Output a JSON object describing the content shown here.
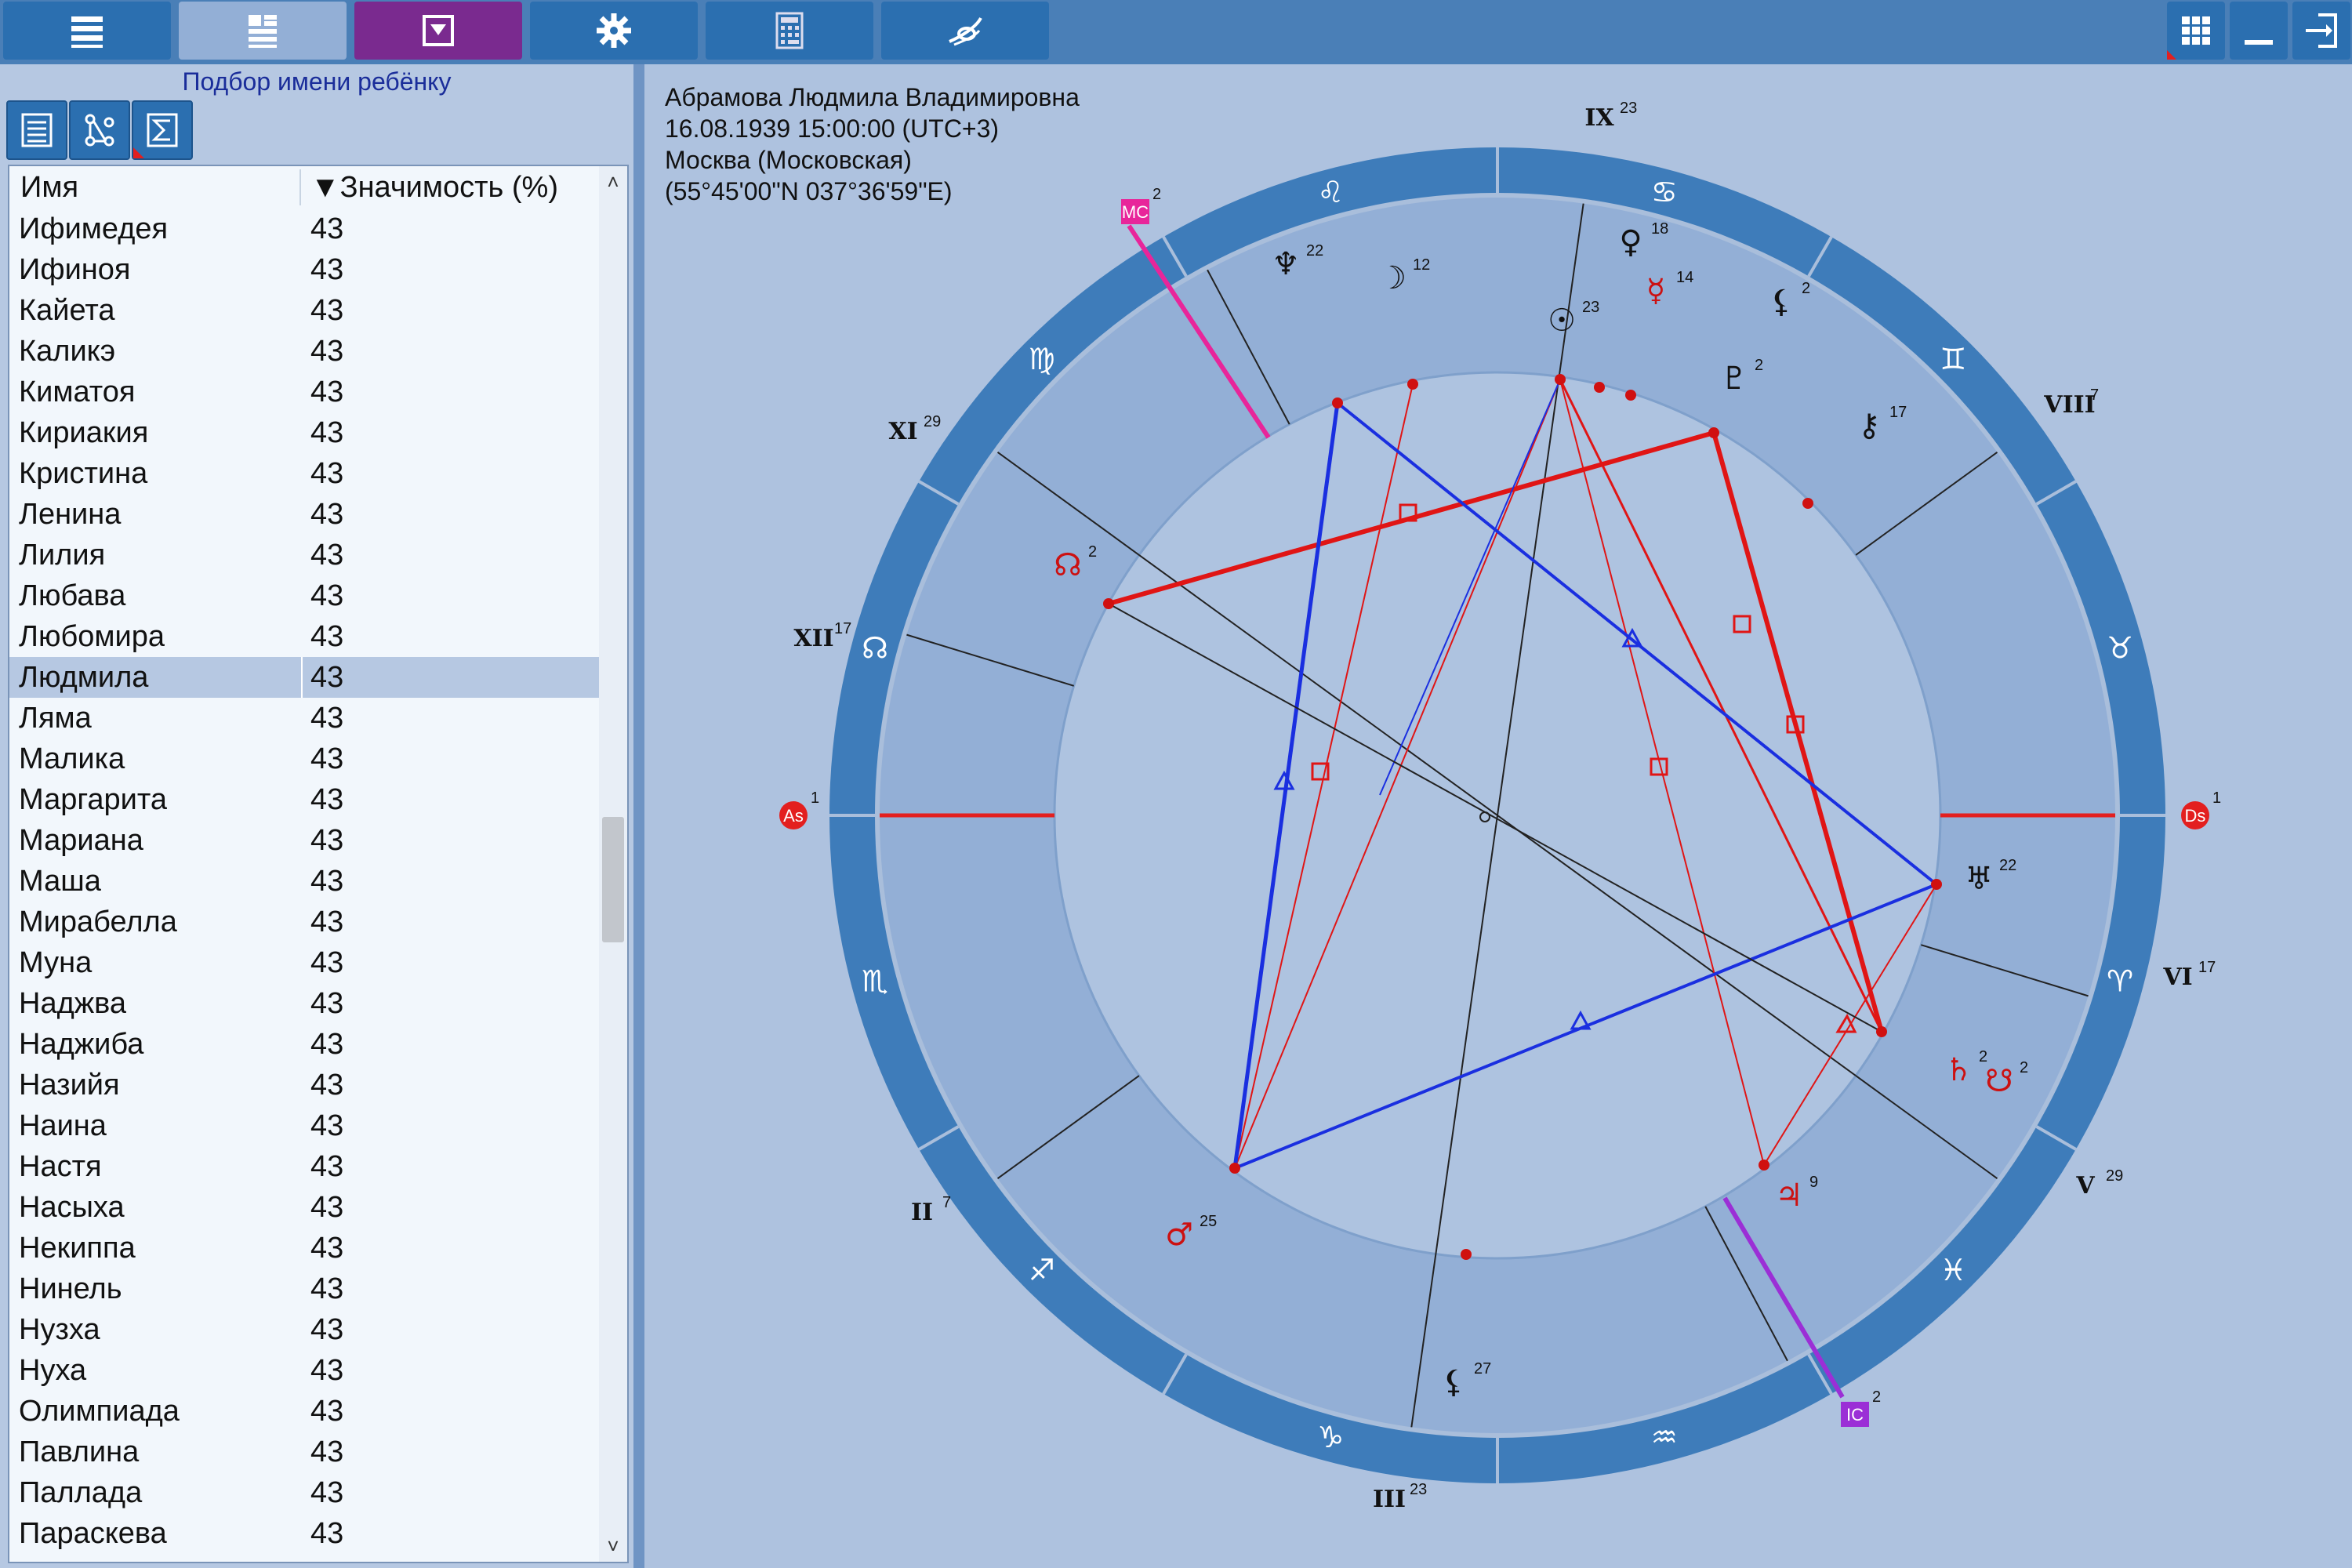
{
  "toolbar": {
    "left_buttons": [
      "menu-icon",
      "layout-icon",
      "dropdown-icon",
      "gear-icon",
      "calculator-icon",
      "logo-icon"
    ],
    "right_buttons": [
      "grid-icon",
      "minimize-icon",
      "exit-icon"
    ]
  },
  "panel": {
    "title": "Подбор имени ребёнку",
    "tools": [
      "list-icon",
      "diagram-icon",
      "sigma-icon"
    ]
  },
  "table": {
    "col_name": "Имя",
    "col_value": "▼Значимость (%)",
    "selected_index": 11,
    "rows": [
      {
        "name": "Ифимедея",
        "value": "43"
      },
      {
        "name": "Ифиноя",
        "value": "43"
      },
      {
        "name": "Кайета",
        "value": "43"
      },
      {
        "name": "Каликэ",
        "value": "43"
      },
      {
        "name": "Киматоя",
        "value": "43"
      },
      {
        "name": "Кириакия",
        "value": "43"
      },
      {
        "name": "Кристина",
        "value": "43"
      },
      {
        "name": "Ленина",
        "value": "43"
      },
      {
        "name": "Лилия",
        "value": "43"
      },
      {
        "name": "Любава",
        "value": "43"
      },
      {
        "name": "Любомира",
        "value": "43"
      },
      {
        "name": "Людмила",
        "value": "43"
      },
      {
        "name": "Ляма",
        "value": "43"
      },
      {
        "name": "Малика",
        "value": "43"
      },
      {
        "name": "Маргарита",
        "value": "43"
      },
      {
        "name": "Мариана",
        "value": "43"
      },
      {
        "name": "Маша",
        "value": "43"
      },
      {
        "name": "Мирабелла",
        "value": "43"
      },
      {
        "name": "Муна",
        "value": "43"
      },
      {
        "name": "Наджва",
        "value": "43"
      },
      {
        "name": "Наджиба",
        "value": "43"
      },
      {
        "name": "Назийя",
        "value": "43"
      },
      {
        "name": "Наина",
        "value": "43"
      },
      {
        "name": "Настя",
        "value": "43"
      },
      {
        "name": "Насыха",
        "value": "43"
      },
      {
        "name": "Некиппа",
        "value": "43"
      },
      {
        "name": "Нинель",
        "value": "43"
      },
      {
        "name": "Нузха",
        "value": "43"
      },
      {
        "name": "Нуха",
        "value": "43"
      },
      {
        "name": "Олимпиада",
        "value": "43"
      },
      {
        "name": "Павлина",
        "value": "43"
      },
      {
        "name": "Паллада",
        "value": "43"
      },
      {
        "name": "Параскева",
        "value": "43"
      }
    ]
  },
  "chart_info": {
    "name": "Абрамова Людмила Владимировна",
    "datetime": "16.08.1939 15:00:00 (UTC+3)",
    "place": "Москва (Московская)",
    "coords": "(55°45'00\"N 037°36'59\"E)"
  },
  "wheel": {
    "zodiac_signs": [
      {
        "symbol": "♌",
        "name": "leo"
      },
      {
        "symbol": "♋",
        "name": "cancer"
      },
      {
        "symbol": "♊",
        "name": "gemini"
      },
      {
        "symbol": "♉",
        "name": "taurus"
      },
      {
        "symbol": "♈",
        "name": "aries"
      },
      {
        "symbol": "♓",
        "name": "pisces"
      },
      {
        "symbol": "♒",
        "name": "aquarius"
      },
      {
        "symbol": "♑",
        "name": "capricorn"
      },
      {
        "symbol": "♐",
        "name": "sagittarius"
      },
      {
        "symbol": "♏",
        "name": "scorpio"
      },
      {
        "symbol": "☊",
        "name": "node"
      },
      {
        "symbol": "♍",
        "name": "virgo"
      }
    ],
    "houses": [
      {
        "num": "IX",
        "deg": "23"
      },
      {
        "num": "VIII",
        "deg": "7"
      },
      {
        "num": "VII",
        "deg": "1"
      },
      {
        "num": "VI",
        "deg": "17"
      },
      {
        "num": "V",
        "deg": "29"
      },
      {
        "num": "IV",
        "deg": "2"
      },
      {
        "num": "III",
        "deg": "23"
      },
      {
        "num": "II",
        "deg": "7"
      },
      {
        "num": "I",
        "deg": "1"
      },
      {
        "num": "XII",
        "deg": "17"
      },
      {
        "num": "XI",
        "deg": "29"
      },
      {
        "num": "X",
        "deg": "2"
      }
    ],
    "angles": [
      {
        "label": "MC",
        "deg": "2",
        "color": "#e8259a"
      },
      {
        "label": "IC",
        "deg": "2",
        "color": "#9b2fd6"
      },
      {
        "label": "As",
        "deg": "1",
        "color": "#e31f1f"
      },
      {
        "label": "Ds",
        "deg": "1",
        "color": "#e31f1f"
      }
    ],
    "planets": [
      {
        "symbol": "♀",
        "deg": "18",
        "color": "#111111"
      },
      {
        "symbol": "☿",
        "deg": "14",
        "color": "#cc1111"
      },
      {
        "symbol": "☉",
        "deg": "23",
        "color": "#111111"
      },
      {
        "symbol": "☽",
        "deg": "12",
        "color": "#111111"
      },
      {
        "symbol": "♆",
        "deg": "22",
        "color": "#111111"
      },
      {
        "symbol": "⚸",
        "deg": "2",
        "color": "#111111"
      },
      {
        "symbol": "♇",
        "deg": "2",
        "color": "#111111"
      },
      {
        "symbol": "⚷",
        "deg": "17",
        "color": "#111111"
      },
      {
        "symbol": "☊",
        "deg": "2",
        "color": "#cc1111"
      },
      {
        "symbol": "♅",
        "deg": "22",
        "color": "#111111"
      },
      {
        "symbol": "♄",
        "deg": "2",
        "color": "#cc1111"
      },
      {
        "symbol": "☋",
        "deg": "2",
        "color": "#cc1111"
      },
      {
        "symbol": "♃",
        "deg": "9",
        "color": "#cc1111"
      },
      {
        "symbol": "♂",
        "deg": "25",
        "color": "#cc1111"
      },
      {
        "symbol": "⚸",
        "deg": "27",
        "color": "#111111"
      }
    ],
    "colors": {
      "ring_dark": "#3e7cba",
      "ring_light": "#93afd6",
      "center": "#aec3e0",
      "aspect_red": "#e01515",
      "aspect_blue": "#1a2fe0"
    }
  }
}
